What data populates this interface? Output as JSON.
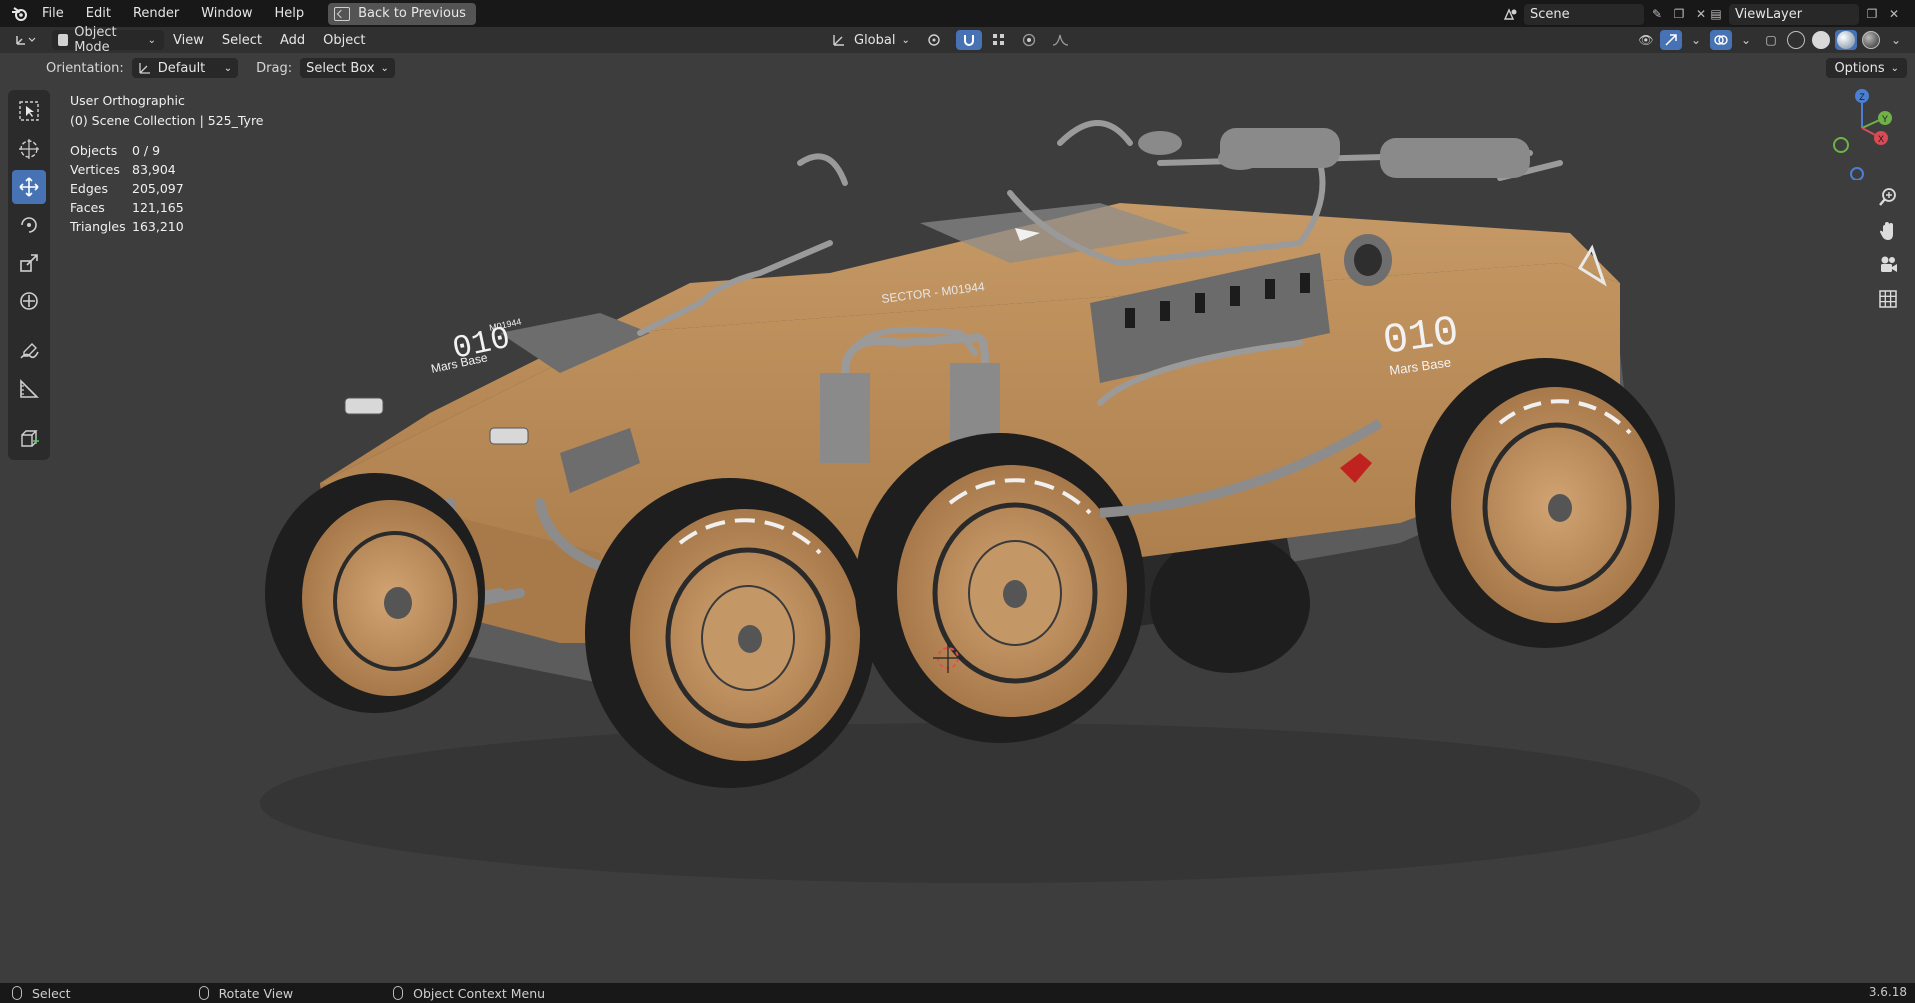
{
  "menubar": {
    "items": [
      "File",
      "Edit",
      "Render",
      "Window",
      "Help"
    ],
    "back_button": "Back to Previous",
    "scene_name": "Scene",
    "view_layer": "ViewLayer"
  },
  "header": {
    "mode": "Object Mode",
    "menus": [
      "View",
      "Select",
      "Add",
      "Object"
    ],
    "transform_orientation": "Global"
  },
  "tool_settings": {
    "orientation_label": "Orientation:",
    "orientation_value": "Default",
    "drag_label": "Drag:",
    "drag_value": "Select Box",
    "options_label": "Options"
  },
  "overlay": {
    "view_name": "User Orthographic",
    "collection": "(0) Scene Collection | 525_Tyre",
    "stats": [
      {
        "label": "Objects",
        "value": "0 / 9"
      },
      {
        "label": "Vertices",
        "value": "83,904"
      },
      {
        "label": "Edges",
        "value": "205,097"
      },
      {
        "label": "Faces",
        "value": "121,165"
      },
      {
        "label": "Triangles",
        "value": "163,210"
      }
    ]
  },
  "model_decals": {
    "sector": "SECTOR - M01944",
    "number": "010",
    "base": "Mars Base",
    "front_code": "M01944"
  },
  "gizmo": {
    "z": "Z",
    "y": "Y",
    "x": "X"
  },
  "statusbar": {
    "select": "Select",
    "rotate": "Rotate View",
    "context": "Object Context Menu",
    "version": "3.6.18"
  },
  "colors": {
    "accent": "#4772b3",
    "body": "#b98a55",
    "tyre": "#1e1e1e"
  }
}
